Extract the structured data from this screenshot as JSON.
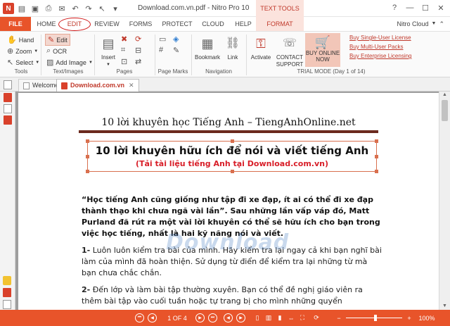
{
  "window": {
    "title": "Download.com.vn.pdf - Nitro Pro 10",
    "context_tab_group": "TEXT TOOLS",
    "user": "Nitro Cloud"
  },
  "tabs": [
    "FILE",
    "HOME",
    "EDIT",
    "REVIEW",
    "FORMS",
    "PROTECT",
    "CLOUD",
    "HELP",
    "FORMAT"
  ],
  "ribbon": {
    "tools": {
      "hand": "Hand",
      "zoom": "Zoom",
      "select": "Select",
      "label": "Tools"
    },
    "text_images": {
      "edit": "Edit",
      "ocr": "OCR",
      "add_image": "Add Image",
      "label": "Text/Images"
    },
    "pages": {
      "insert": "Insert",
      "label": "Pages"
    },
    "page_marks": {
      "label": "Page Marks"
    },
    "navigation": {
      "bookmark": "Bookmark",
      "link": "Link",
      "label": "Navigation"
    },
    "trial": {
      "activate": "Activate",
      "contact_support": "CONTACT SUPPORT",
      "buy_online": "BUY ONLINE NOW",
      "label": "TRIAL MODE (Day 1 of 14)",
      "links": [
        "Buy Single-User License",
        "Buy Multi-User Packs",
        "Buy Enterprise Licensing"
      ]
    }
  },
  "doc_tabs": [
    "Welcome",
    "Download.com.vn"
  ],
  "document": {
    "header": "10 lời khuyên học Tiếng Anh – TiengAnhOnline.net",
    "title": "10 lời khuyên hữu ích để nói và viết tiếng Anh",
    "subtitle": "(Tải tài liệu tiếng Anh tại Download.com.vn)",
    "quote": "“Học tiếng Anh cũng giống như tập đi xe đạp, ít ai có thể đi xe đạp thành thạo khi chưa ngã vài lần”. Sau những lần vấp váp đó, Matt Purland đã rút ra một vài lời khuyên có thể sẽ hữu ích cho bạn trong việc học tiếng, nhất là hai kỹ năng nói và viết.",
    "items": [
      {
        "num": "1-",
        "text": "Luôn luôn kiểm tra bài của mình. Hãy kiểm tra lại ngay cả khi bạn nghĩ bài làm của mình đã hoàn thiện. Sử dụng từ điển để kiểm tra lại những từ mà bạn chưa chắc chắn."
      },
      {
        "num": "2-",
        "text": "Đến lớp và làm bài tập thường xuyên. Bạn có thể đề nghị giáo viên ra thêm bài tập vào cuối tuần hoặc tự trang bị cho mình những quyển"
      }
    ],
    "watermark": "Download"
  },
  "status": {
    "page": "1 OF 4",
    "zoom": "100%"
  }
}
